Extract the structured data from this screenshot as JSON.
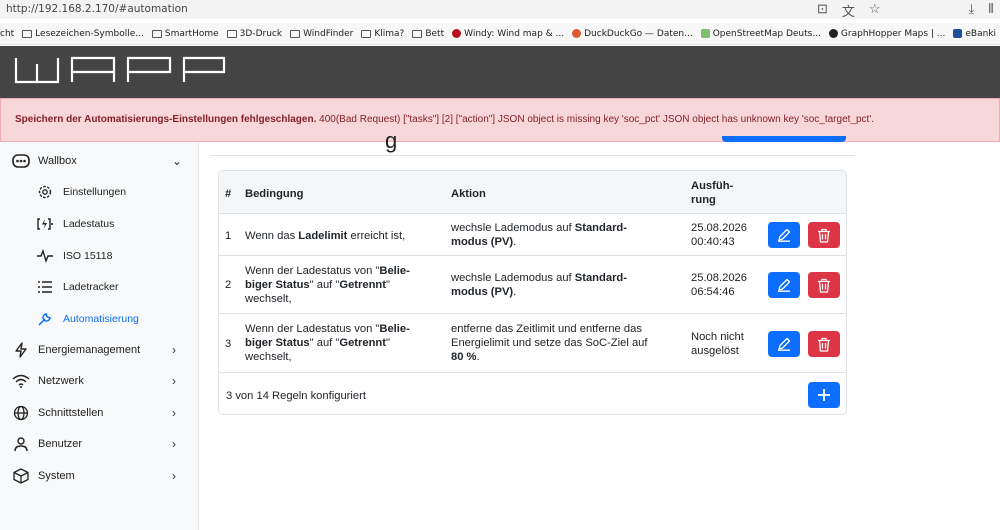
{
  "browser": {
    "url": "http://192.168.2.170/#automation",
    "bookmarks": [
      {
        "label": "cht",
        "icon": "none"
      },
      {
        "label": "Lesezeichen-Symbolle...",
        "icon": "folder-icon"
      },
      {
        "label": "SmartHome",
        "icon": "folder-icon"
      },
      {
        "label": "3D-Druck",
        "icon": "folder-icon"
      },
      {
        "label": "WindFinder",
        "icon": "folder-icon"
      },
      {
        "label": "Klima?",
        "icon": "folder-icon"
      },
      {
        "label": "Bett",
        "icon": "folder-icon"
      },
      {
        "label": "Windy: Wind map & ...",
        "icon": "windy-icon"
      },
      {
        "label": "DuckDuckGo — Daten...",
        "icon": "duckduckgo-icon"
      },
      {
        "label": "OpenStreetMap Deuts...",
        "icon": "osm-icon"
      },
      {
        "label": "GraphHopper Maps | ...",
        "icon": "graphhopper-icon"
      },
      {
        "label": "eBanki",
        "icon": "bank-icon"
      }
    ]
  },
  "alert": {
    "bold": "Speichern der Automatisierungs-Einstellungen fehlgeschlagen.",
    "text": " 400(Bad Request) [\"tasks\"] [2] [\"action\"] JSON object is missing key 'soc_pct' JSON object has unknown key 'soc_target_pct'."
  },
  "page_title_fragment": "g",
  "sidebar": {
    "wallbox": "Wallbox",
    "sub": [
      "Einstellungen",
      "Ladestatus",
      "ISO 15118",
      "Ladetracker",
      "Automatisierung"
    ],
    "main": [
      "Energiemanagement",
      "Netzwerk",
      "Schnittstellen",
      "Benutzer",
      "System"
    ]
  },
  "table": {
    "headers": {
      "num": "#",
      "condition": "Bedingung",
      "action": "Aktion",
      "executed_1": "Ausfüh-",
      "executed_2": "rung"
    },
    "rows": [
      {
        "num": "1",
        "cond": [
          "Wenn das ",
          "Ladelimit",
          " erreicht ist,"
        ],
        "act1": [
          "wechsle Lademodus auf ",
          "Standard-"
        ],
        "act2": [
          "modus (PV)",
          "."
        ],
        "exec1": "25.08.2026",
        "exec2": "00:40:43"
      },
      {
        "num": "2",
        "cond1": [
          "Wenn der Ladestatus von \"",
          "Belie-"
        ],
        "cond2": [
          "biger Status",
          "\" auf \"",
          "Getrennt",
          "\""
        ],
        "cond3": "wechselt,",
        "act1": [
          "wechsle Lademodus auf ",
          "Standard-"
        ],
        "act2": [
          "modus (PV)",
          "."
        ],
        "exec1": "25.08.2026",
        "exec2": "06:54:46"
      },
      {
        "num": "3",
        "cond1": [
          "Wenn der Ladestatus von \"",
          "Belie-"
        ],
        "cond2": [
          "biger Status",
          "\" auf \"",
          "Getrennt",
          "\""
        ],
        "cond3": "wechselt,",
        "act1": "entferne das Zeitlimit und entferne das",
        "act2": "Energielimit und setze das SoC-Ziel auf",
        "act3": "80 %",
        "act3b": ".",
        "exec1": "Noch nicht",
        "exec2": "ausgelöst"
      }
    ],
    "footer": "3 von 14 Regeln konfiguriert"
  }
}
